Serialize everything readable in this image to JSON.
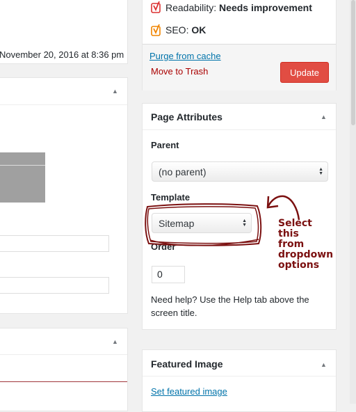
{
  "publish": {
    "readability_label": "Readability:",
    "readability_value": "Needs improvement",
    "seo_label": "SEO:",
    "seo_value": "OK",
    "purge_link": "Purge from cache",
    "trash_link": "Move to Trash",
    "update_button": "Update"
  },
  "left": {
    "timestamp": "November 20, 2016 at 8:36 pm"
  },
  "page_attributes": {
    "title": "Page Attributes",
    "parent_label": "Parent",
    "parent_value": "(no parent)",
    "template_label": "Template",
    "template_value": "Sitemap",
    "order_label": "Order",
    "order_value": "0",
    "help_text": "Need help? Use the Help tab above the screen title."
  },
  "annotation": {
    "lines": [
      "Select",
      "this",
      "from",
      "dropdown",
      "options"
    ]
  },
  "featured_image": {
    "title": "Featured Image",
    "set_link": "Set featured image"
  },
  "colors": {
    "link": "#0073aa",
    "trash": "#a00",
    "update_button": "#e14d43",
    "annotation": "#7b1010",
    "yoast_orange": "#f18500",
    "yoast_red": "#dc3232"
  },
  "icons": {
    "toggle": "triangle-up-icon",
    "select_arrows": "select-arrows-icon",
    "yoast_readability": "yoast-red-icon",
    "yoast_seo": "yoast-orange-icon"
  }
}
